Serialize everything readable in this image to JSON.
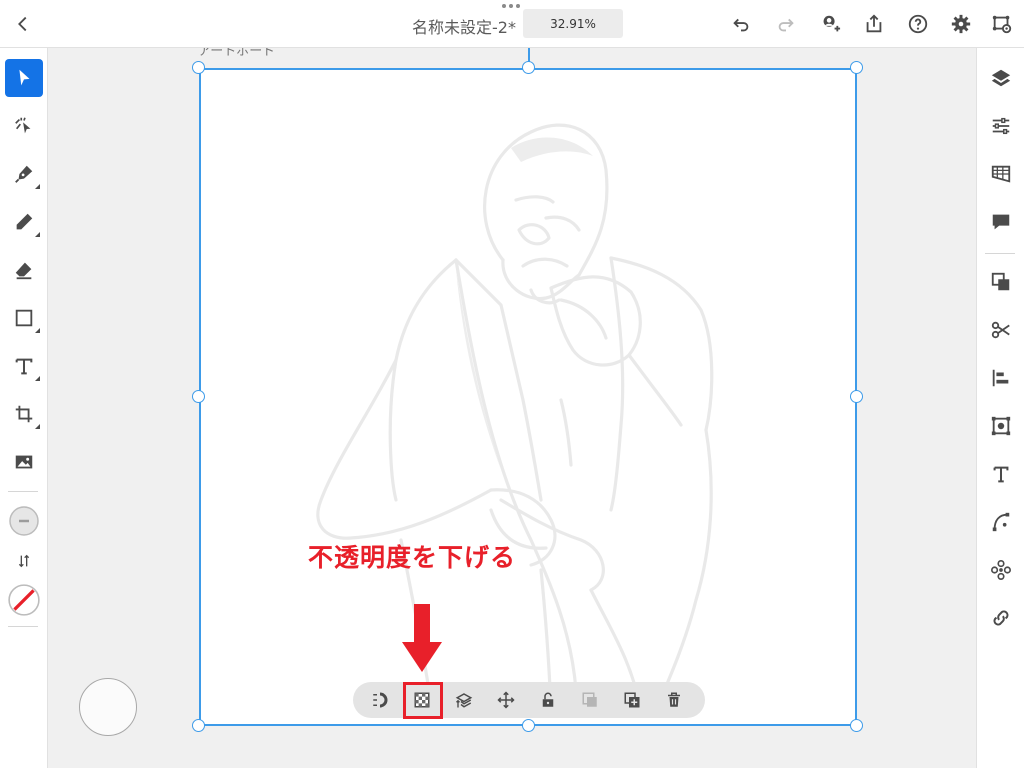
{
  "document": {
    "title": "名称未設定-2*",
    "zoom": "32.91%"
  },
  "artboard": {
    "label": "アートボード"
  },
  "annotation": {
    "text": "不透明度を下げる",
    "color": "#e8202a"
  },
  "colors": {
    "accent": "#1473e6",
    "selection": "#3d9be9",
    "annotation": "#e8202a"
  },
  "topbar": {
    "left_icons": [
      "back-chevron-icon"
    ],
    "right_icons": [
      "undo-icon",
      "redo-icon",
      "invite-user-icon",
      "share-icon",
      "help-icon",
      "settings-icon",
      "cloud-document-icon"
    ]
  },
  "left_tools": [
    "select-tool-icon",
    "direct-select-tool-icon",
    "pen-tool-icon",
    "pencil-tool-icon",
    "eraser-tool-icon",
    "rectangle-tool-icon",
    "type-tool-icon",
    "crop-tool-icon",
    "image-tool-icon",
    "fill-swatch",
    "swap-colors-icon",
    "stroke-swatch-none"
  ],
  "right_panel": [
    "layers-icon",
    "properties-icon",
    "libraries-icon",
    "comments-icon",
    "arrange-icon",
    "cut-icon",
    "align-icon",
    "transform-icon",
    "type-panel-icon",
    "path-icon",
    "repeat-icon",
    "link-icon"
  ],
  "context_toolbar": [
    "magnet-icon",
    "opacity-icon",
    "arrange-layer-icon",
    "move-icon",
    "lock-icon",
    "duplicate-disabled-icon",
    "copy-add-icon",
    "trash-icon"
  ]
}
